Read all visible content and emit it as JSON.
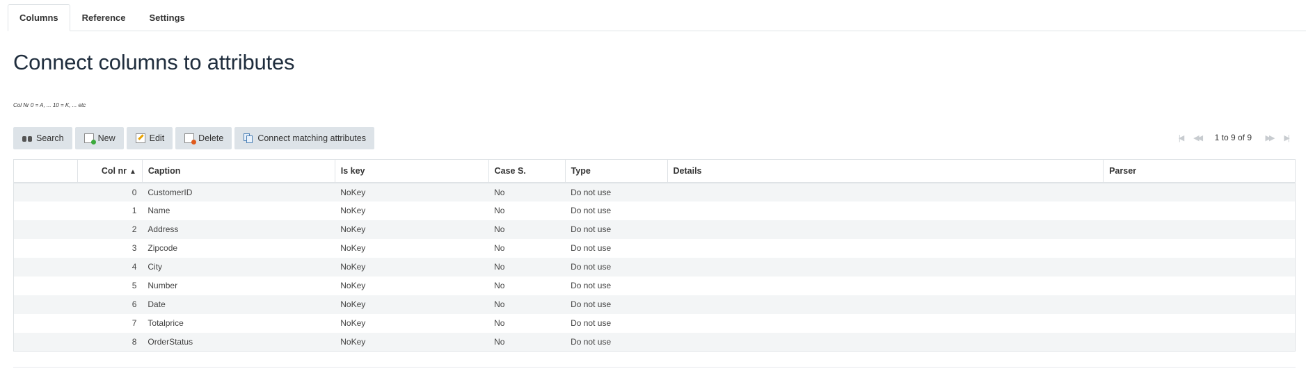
{
  "tabs": [
    {
      "label": "Columns",
      "active": true
    },
    {
      "label": "Reference",
      "active": false
    },
    {
      "label": "Settings",
      "active": false
    }
  ],
  "page_title": "Connect columns to attributes",
  "hint": "Col Nr 0 = A, ... 10 = K, ... etc",
  "toolbar": {
    "search": "Search",
    "new": "New",
    "edit": "Edit",
    "delete": "Delete",
    "connect": "Connect matching attributes"
  },
  "pager": {
    "info": "1 to 9 of 9"
  },
  "grid": {
    "headers": {
      "select": "",
      "colnr": "Col nr",
      "sort_indicator": "▲",
      "caption": "Caption",
      "iskey": "Is key",
      "cases": "Case S.",
      "type": "Type",
      "details": "Details",
      "parser": "Parser"
    },
    "rows": [
      {
        "colnr": "0",
        "caption": "CustomerID",
        "iskey": "NoKey",
        "cases": "No",
        "type": "Do not use",
        "details": "",
        "parser": ""
      },
      {
        "colnr": "1",
        "caption": "Name",
        "iskey": "NoKey",
        "cases": "No",
        "type": "Do not use",
        "details": "",
        "parser": ""
      },
      {
        "colnr": "2",
        "caption": "Address",
        "iskey": "NoKey",
        "cases": "No",
        "type": "Do not use",
        "details": "",
        "parser": ""
      },
      {
        "colnr": "3",
        "caption": "Zipcode",
        "iskey": "NoKey",
        "cases": "No",
        "type": "Do not use",
        "details": "",
        "parser": ""
      },
      {
        "colnr": "4",
        "caption": "City",
        "iskey": "NoKey",
        "cases": "No",
        "type": "Do not use",
        "details": "",
        "parser": ""
      },
      {
        "colnr": "5",
        "caption": "Number",
        "iskey": "NoKey",
        "cases": "No",
        "type": "Do not use",
        "details": "",
        "parser": ""
      },
      {
        "colnr": "6",
        "caption": "Date",
        "iskey": "NoKey",
        "cases": "No",
        "type": "Do not use",
        "details": "",
        "parser": ""
      },
      {
        "colnr": "7",
        "caption": "Totalprice",
        "iskey": "NoKey",
        "cases": "No",
        "type": "Do not use",
        "details": "",
        "parser": ""
      },
      {
        "colnr": "8",
        "caption": "OrderStatus",
        "iskey": "NoKey",
        "cases": "No",
        "type": "Do not use",
        "details": "",
        "parser": ""
      }
    ]
  }
}
